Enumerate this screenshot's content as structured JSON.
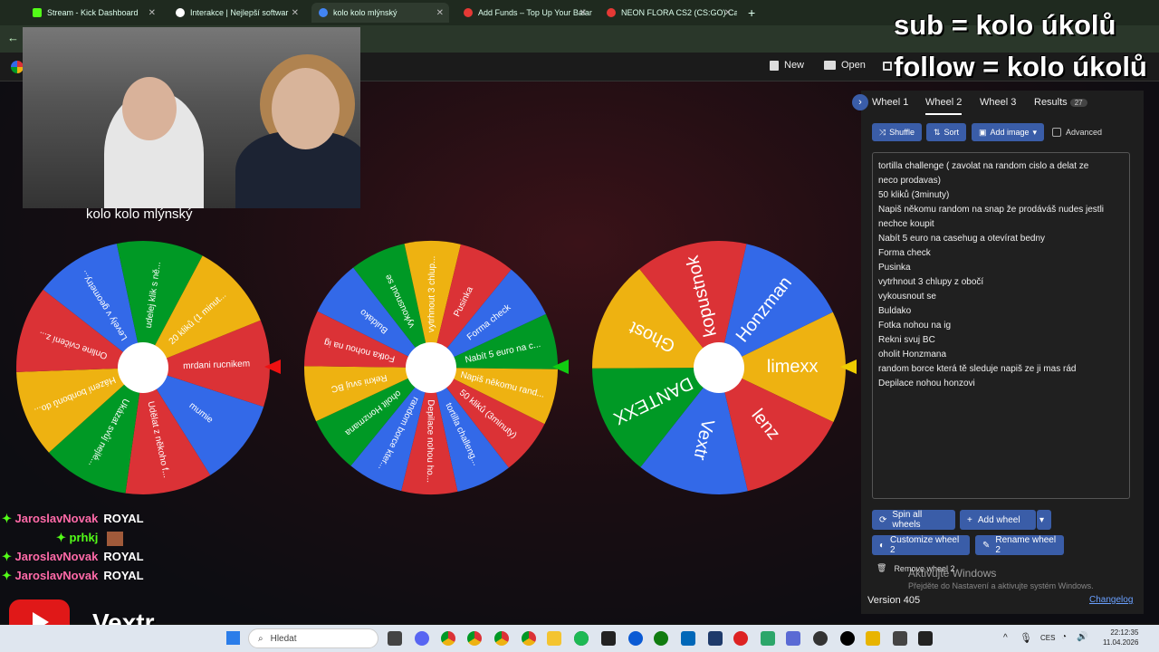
{
  "browser": {
    "tabs": [
      {
        "label": "Stream - Kick Dashboard",
        "color": "#53fc18"
      },
      {
        "label": "Interakce | Nejlepší softwar",
        "color": "#ffffff"
      },
      {
        "label": "kolo kolo mlýnský",
        "color": "#4285f4"
      },
      {
        "label": "Add Funds – Top Up Your Balan",
        "color": "#e53935"
      },
      {
        "label": "NEON FLORA CS2 (CS:GO) Case",
        "color": "#e53935"
      }
    ],
    "new_tab": "+"
  },
  "app_toolbar": {
    "new_label": "New",
    "open_label": "Open"
  },
  "overlay": {
    "line1": "sub = kolo úkolů",
    "line2": "follow = kolo úkolů"
  },
  "webcam": {
    "caption": "kolo kolo mlýnský"
  },
  "wheels": [
    {
      "segments": [
        {
          "label": "mrdani rucnikem",
          "color": "#db3236"
        },
        {
          "label": "mumie",
          "color": "#3369e8"
        },
        {
          "label": "Udělat z někoho f...",
          "color": "#db3236"
        },
        {
          "label": "Ukázat svůj nejlé...",
          "color": "#009925"
        },
        {
          "label": "Házení bonbonů do...",
          "color": "#eeb211"
        },
        {
          "label": "Online cvičení z...",
          "color": "#db3236"
        },
        {
          "label": "Levely v geometry...",
          "color": "#3369e8"
        },
        {
          "label": "udelej klik s ně...",
          "color": "#009925"
        },
        {
          "label": "20 kliků (1 minut...",
          "color": "#eeb211"
        }
      ]
    },
    {
      "segments": [
        {
          "label": "Nabít 5 euro na c...",
          "color": "#009925"
        },
        {
          "label": "Napiš někomu rand...",
          "color": "#eeb211"
        },
        {
          "label": "50 kliků (3minuty)",
          "color": "#db3236"
        },
        {
          "label": "tortilla challeng...",
          "color": "#3369e8"
        },
        {
          "label": "Depilace nohou ho...",
          "color": "#db3236"
        },
        {
          "label": "random borce kter...",
          "color": "#3369e8"
        },
        {
          "label": "oholit Honzmana",
          "color": "#009925"
        },
        {
          "label": "Rekni svuj BC",
          "color": "#eeb211"
        },
        {
          "label": "Fotka nohou na ig",
          "color": "#db3236"
        },
        {
          "label": "Buldako",
          "color": "#3369e8"
        },
        {
          "label": "vykousnout se",
          "color": "#009925"
        },
        {
          "label": "vytrhnout 3 chlup...",
          "color": "#eeb211"
        },
        {
          "label": "Pusinka",
          "color": "#db3236"
        },
        {
          "label": "Forma check",
          "color": "#3369e8"
        }
      ]
    },
    {
      "segments": [
        {
          "label": "limexx",
          "color": "#eeb211"
        },
        {
          "label": "lenz",
          "color": "#db3236"
        },
        {
          "label": "Vextr",
          "color": "#3369e8"
        },
        {
          "label": "DANTEXX",
          "color": "#009925"
        },
        {
          "label": "Ghost",
          "color": "#eeb211"
        },
        {
          "label": "kopustnok",
          "color": "#db3236"
        },
        {
          "label": "Honzman",
          "color": "#3369e8"
        }
      ]
    }
  ],
  "panel": {
    "tabs": [
      "Wheel 1",
      "Wheel 2",
      "Wheel 3",
      "Results"
    ],
    "results_count": "27",
    "shuffle": "Shuffle",
    "sort": "Sort",
    "add_image": "Add image",
    "advanced": "Advanced",
    "entries": [
      "tortilla challenge ( zavolat na random cislo a delat ze",
      "neco prodavas)",
      "50 kliků (3minuty)",
      "Napiš někomu random na snap že prodáváš nudes jestli",
      "nechce koupit",
      "Nabít 5 euro na casehug a otevírat bedny",
      "Forma check",
      "Pusinka",
      "vytrhnout 3 chlupy z obočí",
      "vykousnout se",
      "Buldako",
      "Fotka nohou na ig",
      "Rekni svuj BC",
      "oholit Honzmana",
      "random borce která tě sleduje napiš ze ji mas rád",
      "Depilace nohou honzovi"
    ],
    "spin_all": "Spin all wheels",
    "add_wheel": "Add wheel",
    "customize": "Customize wheel 2",
    "rename": "Rename wheel 2",
    "remove": "Remove wheel 2",
    "version": "Version 405",
    "changelog": "Changelog"
  },
  "windows_watermark": {
    "title": "Aktivujte Windows",
    "subtitle": "Přejděte do Nastavení a aktivujte systém Windows."
  },
  "chat": [
    {
      "user": "JaroslavNovak",
      "role": "ROYAL"
    },
    {
      "user": "prhkj",
      "role": ""
    },
    {
      "user": "JaroslavNovak",
      "role": "ROYAL"
    },
    {
      "user": "JaroslavNovak",
      "role": "ROYAL"
    }
  ],
  "streamer_name": "Vextr",
  "taskbar": {
    "search_placeholder": "Hledat",
    "lang": "CES",
    "time": "22:12:35",
    "date": "11.04.2026"
  }
}
